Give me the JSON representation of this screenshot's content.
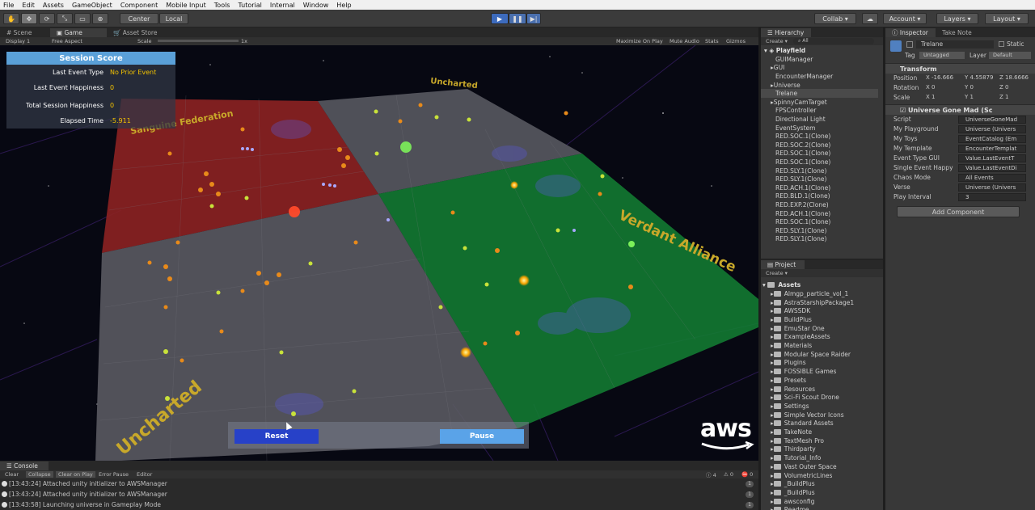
{
  "menu": [
    "File",
    "Edit",
    "Assets",
    "GameObject",
    "Component",
    "Mobile Input",
    "Tools",
    "Tutorial",
    "Internal",
    "Window",
    "Help"
  ],
  "toolbar": {
    "center_label": "Center",
    "local_label": "Local",
    "collab_label": "Collab",
    "account_label": "Account",
    "layers_label": "Layers",
    "layout_label": "Layout",
    "play_icon": "play-icon",
    "pause_icon": "pause-icon",
    "step_icon": "step-icon"
  },
  "game_tabs": [
    "Scene",
    "Game",
    "Asset Store"
  ],
  "game_bar": {
    "display": "Display 1",
    "aspect": "Free Aspect",
    "scale_label": "Scale",
    "scale_value": "1x",
    "maximize": "Maximize On Play",
    "mute": "Mute Audio",
    "stats": "Stats",
    "gizmos": "Gizmos"
  },
  "score": {
    "title": "Session Score",
    "rows": [
      {
        "label": "Last Event Type",
        "value": "No Prior Event"
      },
      {
        "label": "Last Event Happiness",
        "value": "0"
      },
      {
        "label": "Total Session Happiness",
        "value": "0"
      },
      {
        "label": "Elapsed Time",
        "value": "-5.911"
      }
    ]
  },
  "regions": {
    "top_uncharted": "Uncharted",
    "sanguine": "Sanguine Federation",
    "verdant": "Verdant Alliance",
    "bottom_uncharted": "Uncharted"
  },
  "buttons": {
    "reset": "Reset",
    "pause": "Pause"
  },
  "aws": "aws",
  "console": {
    "tab": "Console",
    "buttons": [
      "Clear",
      "Collapse",
      "Clear on Play",
      "Error Pause",
      "Editor"
    ],
    "counts": [
      "4",
      "0",
      "0"
    ],
    "lines": [
      {
        "text": "[13:43:24] Attached unity initializer to AWSManager",
        "count": "1"
      },
      {
        "text": "[13:43:24] Attached unity initializer to AWSManager",
        "count": "1"
      },
      {
        "text": "[13:43:58] Launching universe in Gameplay Mode",
        "count": "1"
      }
    ]
  },
  "hierarchy": {
    "tab": "Hierarchy",
    "create": "Create",
    "search": "All",
    "root": "Playfield",
    "items": [
      "GUIManager",
      "GUI",
      "EncounterManager",
      "Universe",
      "Trelane",
      "SpinnyCamTarget",
      "FPSController",
      "Directional Light",
      "EventSystem",
      "RED.SOC.1(Clone)",
      "RED.SOC.2(Clone)",
      "RED.SOC.1(Clone)",
      "RED.SOC.1(Clone)",
      "RED.SLY.1(Clone)",
      "RED.SLY.1(Clone)",
      "RED.ACH.1(Clone)",
      "RED.BLD.1(Clone)",
      "RED.EXP.2(Clone)",
      "RED.ACH.1(Clone)",
      "RED.SOC.1(Clone)",
      "RED.SLY.1(Clone)",
      "RED.SLY.1(Clone)"
    ],
    "selected": 4
  },
  "project": {
    "tab": "Project",
    "create": "Create",
    "root": "Assets",
    "items": [
      "Almgp_particle_vol_1",
      "AstraStarshipPackage1",
      "AWSSDK",
      "BuildPlus",
      "EmuStar One",
      "ExampleAssets",
      "Materials",
      "Modular Space Raider",
      "Plugins",
      "FOSSIBLE Games",
      "Presets",
      "Resources",
      "Sci-Fi Scout Drone",
      "Settings",
      "Simple Vector Icons",
      "Standard Assets",
      "TakeNote",
      "TextMesh Pro",
      "Thirdparty",
      "Tutorial_Info",
      "Vast Outer Space",
      "VolumetricLines",
      "_BuildPlus",
      "_BuildPlus",
      "awsconfig",
      "Readme"
    ]
  },
  "inspector": {
    "tab": "Inspector",
    "tab2": "Take Note",
    "object_name": "Trelane",
    "static_label": "Static",
    "tag_label": "Tag",
    "tag_value": "Untagged",
    "layer_label": "Layer",
    "layer_value": "Default",
    "transform": "Transform",
    "position": {
      "label": "Position",
      "x": "-16.666",
      "y": "4.55879",
      "z": "18.6666"
    },
    "rotation": {
      "label": "Rotation",
      "x": "0",
      "y": "0",
      "z": "0"
    },
    "scale": {
      "label": "Scale",
      "x": "1",
      "y": "1",
      "z": "1"
    },
    "script_component": "Universe Gone Mad (Sc",
    "fields": [
      {
        "label": "Script",
        "value": "UniverseGoneMad"
      },
      {
        "label": "My Playground",
        "value": "Universe (Univers"
      },
      {
        "label": "My Toys",
        "value": "EventCatalog (Em"
      },
      {
        "label": "My Template",
        "value": "EncounterTemplat"
      },
      {
        "label": "Event Type GUI",
        "value": "Value.LastEventT"
      },
      {
        "label": "Single Event Happy",
        "value": "Value.LastEventDi"
      },
      {
        "label": "Chaos Mode",
        "value": "All Events"
      },
      {
        "label": "Verse",
        "value": "Universe (Univers"
      },
      {
        "label": "Play Interval",
        "value": "3"
      }
    ],
    "add_component": "Add Component"
  },
  "colors": {
    "red_region": "#8a2222",
    "green_region": "#137a32",
    "grey_region": "#5a5a62",
    "score_header": "#5aa0d8",
    "reset_btn": "#2741c8",
    "pause_btn": "#5aa3e8",
    "label_yellow": "#c8a82a"
  }
}
